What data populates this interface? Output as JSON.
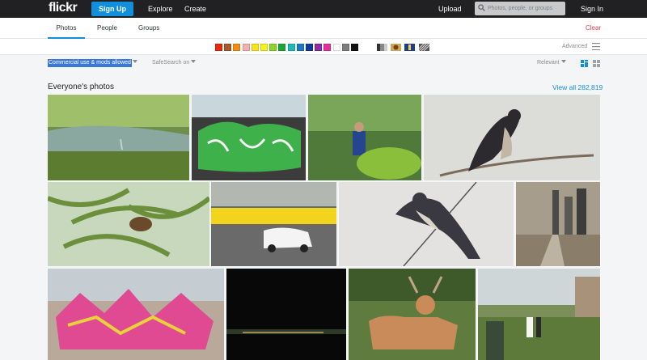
{
  "header": {
    "logo": "flickr",
    "signup_label": "Sign Up",
    "explore_label": "Explore",
    "create_label": "Create",
    "upload_label": "Upload",
    "search_placeholder": "Photos, people, or groups",
    "signin_label": "Sign In"
  },
  "tabs": [
    {
      "label": "Photos",
      "active": true
    },
    {
      "label": "People",
      "active": false
    },
    {
      "label": "Groups",
      "active": false
    }
  ],
  "clear_label": "Clear",
  "color_filters": [
    "#e7290f",
    "#a45a2a",
    "#f28b12",
    "#f5aeb4",
    "#f7e319",
    "#f2f31f",
    "#8ad42c",
    "#1aa735",
    "#1eb8ba",
    "#1d77c7",
    "#123a9e",
    "#8f2ba6",
    "#e42f9c",
    "#ffffff",
    "#7d7d7d",
    "#121212"
  ],
  "style_filters": [
    "black-and-white-icon",
    "shallow-depth-icon",
    "minimalism-icon",
    "patterns-icon"
  ],
  "advanced_label": "Advanced",
  "filters": {
    "license_label": "Commercial use & mods allowed",
    "safesearch_label": "SafeSearch on",
    "sort_label": "Relevant"
  },
  "section": {
    "title": "Everyone's photos",
    "view_all_label": "View all 282,819"
  },
  "colors": {
    "topbar": "#212124",
    "accent": "#128fdc",
    "clear": "#f03c51"
  }
}
